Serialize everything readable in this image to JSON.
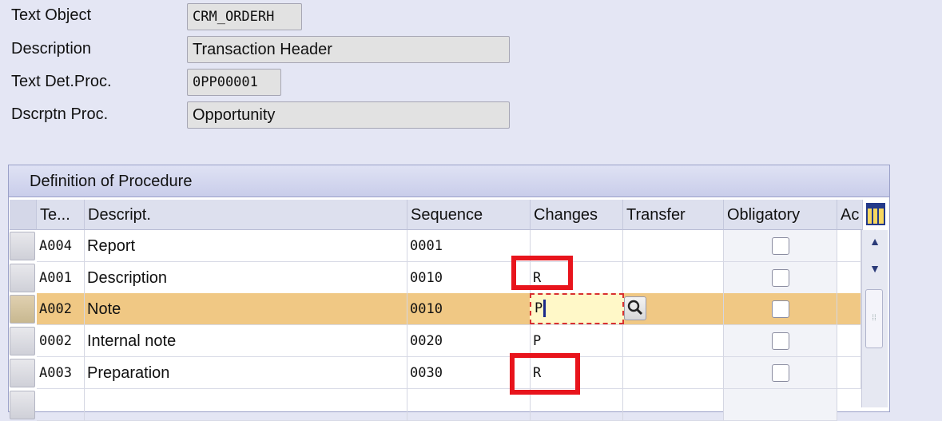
{
  "header_fields": {
    "text_object": {
      "label": "Text Object",
      "value": "CRM_ORDERH"
    },
    "description": {
      "label": "Description",
      "value": "Transaction Header"
    },
    "text_det_proc": {
      "label": "Text Det.Proc.",
      "value": "0PP00001"
    },
    "dscrptn_proc": {
      "label": "Dscrptn Proc.",
      "value": "Opportunity"
    }
  },
  "table": {
    "title": "Definition of Procedure",
    "columns": [
      "Te...",
      "Descript.",
      "Sequence",
      "Changes",
      "Transfer",
      "Obligatory",
      "Ac"
    ],
    "rows": [
      {
        "id": "A004",
        "descript": "Report",
        "sequence": "0001",
        "changes": "",
        "transfer": "",
        "obligatory": false
      },
      {
        "id": "A001",
        "descript": "Description",
        "sequence": "0010",
        "changes": "R",
        "transfer": "",
        "obligatory": false
      },
      {
        "id": "A002",
        "descript": "Note",
        "sequence": "0010",
        "changes": "P",
        "transfer": "",
        "obligatory": false,
        "selected": true
      },
      {
        "id": "0002",
        "descript": "Internal note",
        "sequence": "0020",
        "changes": "P",
        "transfer": "",
        "obligatory": false
      },
      {
        "id": "A003",
        "descript": "Preparation",
        "sequence": "0030",
        "changes": "R",
        "transfer": "",
        "obligatory": false
      }
    ]
  },
  "icons": {
    "search": "magnifier-icon",
    "column_config": "column-config-icon",
    "scroll_up": "scroll-up-icon",
    "scroll_down": "scroll-down-icon"
  },
  "colors": {
    "selected_row": "#f0c884",
    "highlight_box": "#e8141c",
    "background": "#e4e6f4"
  }
}
